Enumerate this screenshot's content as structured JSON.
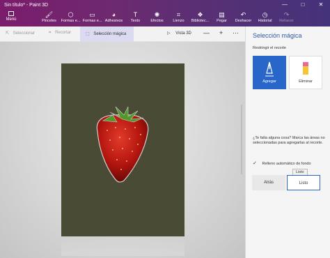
{
  "window": {
    "title": "Sin título* - Paint 3D",
    "controls": [
      "—",
      "□",
      "✕"
    ]
  },
  "ribbon": {
    "menu_label": "Menú",
    "tools": [
      {
        "label": "Pinceles",
        "icon": "brush-icon",
        "glyph": "🖌",
        "enabled": true
      },
      {
        "label": "Formas e...",
        "icon": "shapes-3d-icon",
        "glyph": "⬡",
        "enabled": true
      },
      {
        "label": "Formas e...",
        "icon": "shapes-2d-icon",
        "glyph": "▭",
        "enabled": true
      },
      {
        "label": "Adhesivos",
        "icon": "sticker-icon",
        "glyph": "◕",
        "enabled": true
      },
      {
        "label": "Texto",
        "icon": "text-icon",
        "glyph": "T",
        "enabled": true
      },
      {
        "label": "Efectos",
        "icon": "effects-icon",
        "glyph": "✺",
        "enabled": true
      },
      {
        "label": "Lienzo",
        "icon": "canvas-icon",
        "glyph": "⌗",
        "enabled": true
      },
      {
        "label": "Bibliotec...",
        "icon": "library-icon",
        "glyph": "❖",
        "enabled": true
      },
      {
        "label": "Pegar",
        "icon": "paste-icon",
        "glyph": "▤",
        "enabled": true
      },
      {
        "label": "Deshacer",
        "icon": "undo-icon",
        "glyph": "↶",
        "enabled": true
      },
      {
        "label": "Historial",
        "icon": "history-icon",
        "glyph": "◷",
        "enabled": true
      },
      {
        "label": "Rehacer",
        "icon": "redo-icon",
        "glyph": "↷",
        "enabled": false
      }
    ]
  },
  "toolbar": {
    "select_label": "Seleccionar",
    "crop_label": "Recortar",
    "magic_select_label": "Selección mágica",
    "view3d_label": "Vista 3D",
    "zoom_out": "—",
    "zoom_in": "+",
    "more": "⋯"
  },
  "panel": {
    "title": "Selección mágica",
    "subtitle": "Restringir el recorte",
    "add_label": "Agregar",
    "erase_label": "Eliminar",
    "help_text": "¿Te falta alguna cosa? Marca las áreas no seleccionadas para agregarlas al recorte.",
    "autofill_label": "Relleno automático de fondo",
    "autofill_checked": true,
    "tooltip": "Listo",
    "back_label": "Atrás",
    "done_label": "Listo"
  },
  "colors": {
    "accent": "#2867c9",
    "panel_title": "#2e5aa6",
    "canvas": "#4a4b35"
  }
}
